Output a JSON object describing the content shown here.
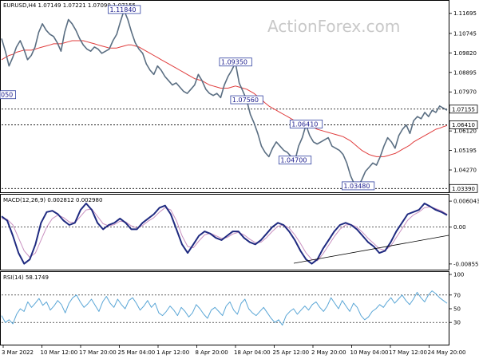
{
  "watermark": "ActionForex.com",
  "colors": {
    "price": "#5a6e82",
    "ma": "#e03c3c",
    "macd": "#1f2a80",
    "signal": "#c990c0",
    "rsi": "#5aa6d6",
    "label_border": "#3040a0",
    "price_tag_border": "#000000",
    "trendline": "#000000"
  },
  "chart_data": [
    {
      "type": "line",
      "title": "EURUSD,H4  1.07149 1.07221 1.07090 1.07155",
      "x": [
        "3 Mar 2022",
        "10 Mar 12:00",
        "17 Mar 20:00",
        "25 Mar 04:00",
        "1 Apr 12:00",
        "8 Apr 20:00",
        "18 Apr 04:00",
        "25 Apr 12:00",
        "2 May 20:00",
        "10 May 04:00",
        "17 May 12:00",
        "24 May 20:00"
      ],
      "ylim": [
        1.0325,
        1.1195
      ],
      "y_ticks": [
        "1.11695",
        "1.10745",
        "1.09820",
        "1.08895",
        "1.07970",
        "1.07045",
        "1.06120",
        "1.05195",
        "1.04270",
        "1.03390"
      ],
      "series": [
        {
          "name": "",
          "values": [
            1.105,
            1.099,
            1.092,
            1.096,
            1.101,
            1.104,
            1.1,
            1.095,
            1.097,
            1.101,
            1.108,
            1.112,
            1.109,
            1.107,
            1.106,
            1.103,
            1.099,
            1.108,
            1.114,
            1.112,
            1.109,
            1.105,
            1.102,
            1.1,
            1.099,
            1.101,
            1.1,
            1.098,
            1.099,
            1.1,
            1.104,
            1.107,
            1.113,
            1.1184,
            1.114,
            1.108,
            1.103,
            1.1,
            1.098,
            1.093,
            1.09,
            1.088,
            1.092,
            1.09,
            1.087,
            1.085,
            1.083,
            1.084,
            1.082,
            1.08,
            1.079,
            1.081,
            1.083,
            1.088,
            1.085,
            1.081,
            1.079,
            1.078,
            1.079,
            1.077,
            1.083,
            1.087,
            1.09,
            1.0935,
            1.084,
            1.08,
            1.076,
            1.069,
            1.065,
            1.06,
            1.054,
            1.051,
            1.049,
            1.053,
            1.056,
            1.054,
            1.052,
            1.051,
            1.049,
            1.047,
            1.054,
            1.058,
            1.0641,
            1.059,
            1.056,
            1.055,
            1.056,
            1.057,
            1.058,
            1.054,
            1.053,
            1.052,
            1.05,
            1.046,
            1.04,
            1.036,
            1.0349,
            1.038,
            1.042,
            1.044,
            1.046,
            1.045,
            1.049,
            1.054,
            1.058,
            1.056,
            1.053,
            1.059,
            1.062,
            1.064,
            1.06,
            1.066,
            1.068,
            1.067,
            1.07,
            1.068,
            1.071,
            1.07,
            1.073,
            1.072,
            1.071
          ]
        },
        {
          "name": "",
          "values": [
            1.095,
            1.096,
            1.097,
            1.0975,
            1.0985,
            1.099,
            1.0995,
            1.0995,
            1.0995,
            1.1,
            1.1005,
            1.101,
            1.1015,
            1.102,
            1.1025,
            1.1025,
            1.1025,
            1.103,
            1.1035,
            1.104,
            1.104,
            1.104,
            1.104,
            1.1035,
            1.103,
            1.1025,
            1.102,
            1.1015,
            1.101,
            1.1005,
            1.1005,
            1.1005,
            1.101,
            1.1015,
            1.102,
            1.102,
            1.1015,
            1.101,
            1.1,
            1.099,
            1.098,
            1.097,
            1.096,
            1.095,
            1.094,
            1.093,
            1.092,
            1.091,
            1.09,
            1.089,
            1.088,
            1.087,
            1.086,
            1.0855,
            1.085,
            1.084,
            1.083,
            1.0825,
            1.082,
            1.0815,
            1.0815,
            1.0815,
            1.082,
            1.0825,
            1.082,
            1.0815,
            1.081,
            1.08,
            1.079,
            1.0775,
            1.076,
            1.0745,
            1.073,
            1.072,
            1.071,
            1.07,
            1.069,
            1.068,
            1.067,
            1.066,
            1.0655,
            1.065,
            1.0648,
            1.064,
            1.063,
            1.062,
            1.0615,
            1.061,
            1.0605,
            1.06,
            1.0595,
            1.059,
            1.0585,
            1.0575,
            1.0565,
            1.055,
            1.0535,
            1.052,
            1.051,
            1.05,
            1.0495,
            1.049,
            1.049,
            1.049,
            1.0495,
            1.05,
            1.0505,
            1.0515,
            1.0525,
            1.0535,
            1.0545,
            1.056,
            1.057,
            1.058,
            1.059,
            1.06,
            1.061,
            1.062,
            1.0625,
            1.0632,
            1.0638
          ]
        }
      ],
      "annotations": [
        {
          "text": "1.11840",
          "value": 1.1184
        },
        {
          "text": "1.09350",
          "value": 1.0935
        },
        {
          "text": "1.07560",
          "value": 1.0756
        },
        {
          "text": "1.06410",
          "value": 1.0641
        },
        {
          "text": "1.04700",
          "value": 1.047
        },
        {
          "text": "1.03480",
          "value": 1.0348
        },
        {
          "text": "050",
          "value": 1.078
        }
      ],
      "price_tags": [
        {
          "text": "1.07155",
          "value": 1.07155
        },
        {
          "text": "1.06410",
          "value": 1.0641
        },
        {
          "text": "1.03390",
          "value": 1.0339
        }
      ],
      "horizontal_levels": [
        1.07155,
        1.0641,
        1.0339
      ]
    },
    {
      "type": "line",
      "title": "MACD(12,26,9) 0.002812 0.002980",
      "ylim": [
        -0.0095,
        0.0068
      ],
      "y_ticks": [
        "0.006043",
        "0.00",
        "-0.008552"
      ],
      "series": [
        {
          "name": "",
          "values": [
            0.0025,
            0.0015,
            -0.002,
            -0.006,
            -0.0085,
            -0.0075,
            -0.004,
            0.001,
            0.0035,
            0.0038,
            0.003,
            0.0015,
            0.0005,
            0.001,
            0.004,
            0.0055,
            0.004,
            0.001,
            -0.0005,
            0.0005,
            0.001,
            0.002,
            0.001,
            -0.0005,
            -0.0005,
            0.001,
            0.002,
            0.003,
            0.0045,
            0.005,
            0.003,
            -0.0005,
            -0.004,
            -0.006,
            -0.004,
            -0.002,
            -0.001,
            -0.0015,
            -0.0025,
            -0.003,
            -0.002,
            -0.001,
            -0.001,
            -0.0025,
            -0.0035,
            -0.004,
            -0.003,
            -0.0015,
            0.0,
            0.001,
            0.0005,
            -0.001,
            -0.003,
            -0.0055,
            -0.0075,
            -0.0085,
            -0.0075,
            -0.005,
            -0.003,
            -0.001,
            0.0005,
            0.001,
            0.0005,
            -0.0005,
            -0.002,
            -0.0035,
            -0.0045,
            -0.006,
            -0.0055,
            -0.0035,
            -0.001,
            0.001,
            0.003,
            0.0035,
            0.004,
            0.0055,
            0.0048,
            0.004,
            0.0035,
            0.0028
          ]
        },
        {
          "name": "",
          "values": [
            0.002,
            0.0018,
            0.0005,
            -0.0025,
            -0.0055,
            -0.007,
            -0.006,
            -0.003,
            0.0,
            0.002,
            0.0028,
            0.0022,
            0.0012,
            0.001,
            0.0025,
            0.004,
            0.0042,
            0.0025,
            0.0008,
            0.0003,
            0.0006,
            0.0014,
            0.0012,
            0.0003,
            -0.0002,
            0.0004,
            0.0014,
            0.0022,
            0.0035,
            0.0045,
            0.004,
            0.0015,
            -0.002,
            -0.0045,
            -0.0048,
            -0.0032,
            -0.0018,
            -0.0014,
            -0.002,
            -0.0026,
            -0.0024,
            -0.0016,
            -0.0012,
            -0.0018,
            -0.0028,
            -0.0036,
            -0.0035,
            -0.0024,
            -0.001,
            0.0002,
            0.0005,
            -0.0002,
            -0.0018,
            -0.0038,
            -0.006,
            -0.0075,
            -0.0078,
            -0.0062,
            -0.0042,
            -0.0022,
            -0.0005,
            0.0005,
            0.0006,
            0.0,
            -0.0012,
            -0.0026,
            -0.0038,
            -0.005,
            -0.0054,
            -0.0044,
            -0.0024,
            -0.0004,
            0.0016,
            0.0028,
            0.0035,
            0.0045,
            0.0047,
            0.0043,
            0.0038,
            0.003
          ]
        }
      ]
    },
    {
      "type": "line",
      "title": "RSI(14) 58.1749",
      "ylim": [
        0,
        100
      ],
      "y_ticks": [
        "100",
        "70",
        "50",
        "30",
        "0"
      ],
      "series": [
        {
          "name": "",
          "values": [
            40,
            30,
            34,
            28,
            42,
            50,
            46,
            60,
            52,
            58,
            65,
            55,
            60,
            48,
            54,
            62,
            56,
            44,
            58,
            66,
            70,
            60,
            52,
            57,
            64,
            55,
            46,
            60,
            68,
            58,
            52,
            64,
            56,
            50,
            62,
            66,
            58,
            48,
            54,
            62,
            52,
            58,
            44,
            40,
            46,
            54,
            48,
            40,
            52,
            46,
            38,
            44,
            56,
            50,
            42,
            36,
            48,
            52,
            46,
            40,
            54,
            60,
            48,
            42,
            58,
            64,
            50,
            44,
            40,
            46,
            52,
            44,
            36,
            30,
            34,
            26,
            40,
            46,
            50,
            42,
            48,
            54,
            48,
            56,
            60,
            52,
            46,
            54,
            66,
            58,
            50,
            62,
            54,
            46,
            58,
            52,
            40,
            34,
            38,
            46,
            50,
            56,
            52,
            60,
            66,
            58,
            64,
            70,
            62,
            56,
            64,
            74,
            66,
            60,
            70,
            76,
            72,
            66,
            62,
            58
          ]
        }
      ]
    }
  ]
}
